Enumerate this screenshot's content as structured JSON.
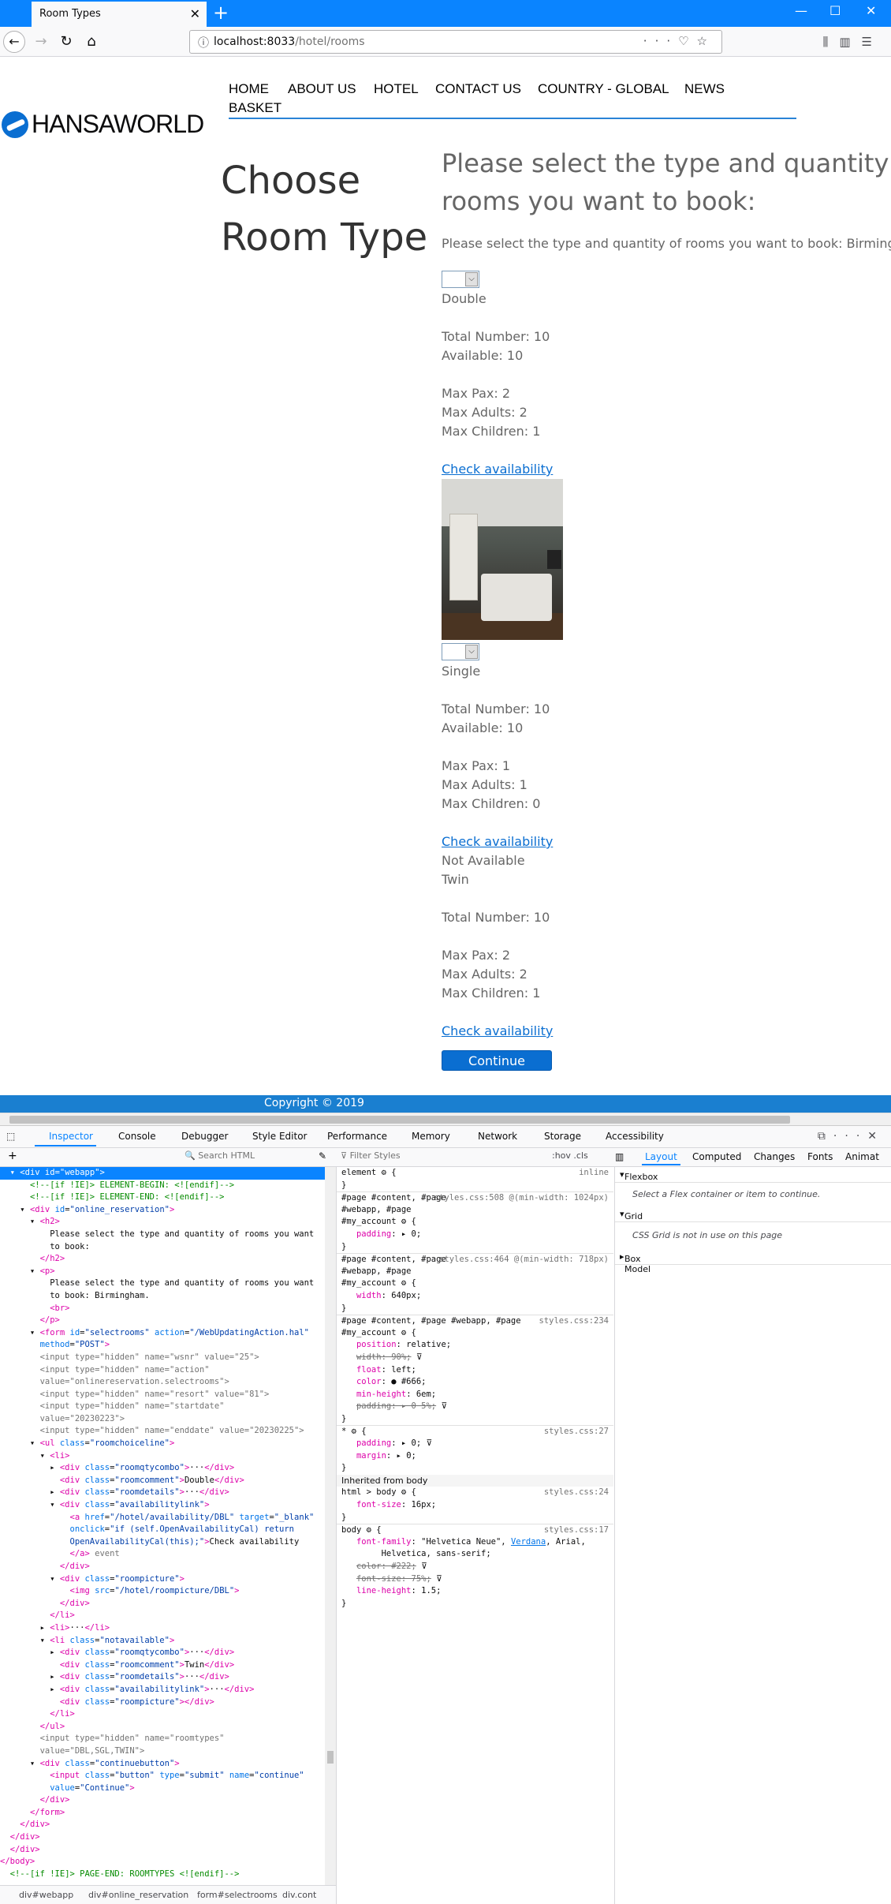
{
  "browser": {
    "tab_title": "Room Types",
    "url_host": "localhost:8033",
    "url_path": "/hotel/rooms"
  },
  "site": {
    "logo_text": "HANSAWORLD",
    "menu": [
      "HOME",
      "ABOUT US",
      "HOTEL",
      "CONTACT US",
      "COUNTRY - GLOBAL",
      "NEWS",
      "BASKET"
    ],
    "page_title_line1": "Choose",
    "page_title_line2": "Room Type",
    "heading_line1": "Please select the type and quantity of",
    "heading_line2": "rooms you want to book:",
    "lead": "Please select the type and quantity of rooms you want to book: Birmingham.",
    "rooms": [
      {
        "name": "Double",
        "total": "Total Number: 10",
        "available": "Available: 10",
        "max_pax": "Max Pax: 2",
        "max_adults": "Max Adults: 2",
        "max_children": "Max Children: 1",
        "link": "Check availability"
      },
      {
        "name": "Single",
        "total": "Total Number: 10",
        "available": "Available: 10",
        "max_pax": "Max Pax: 1",
        "max_adults": "Max Adults: 1",
        "max_children": "Max Children: 0",
        "link": "Check availability"
      },
      {
        "not_available": "Not Available",
        "name": "Twin",
        "total": "Total Number: 10",
        "max_pax": "Max Pax: 2",
        "max_adults": "Max Adults: 2",
        "max_children": "Max Children: 1",
        "link": "Check availability"
      }
    ],
    "continue_label": "Continue",
    "footer": "Copyright © 2019"
  },
  "devtools": {
    "tabs": [
      "Inspector",
      "Console",
      "Debugger",
      "Style Editor",
      "Performance",
      "Memory",
      "Network",
      "Storage",
      "Accessibility"
    ],
    "search_placeholder": "Search HTML",
    "filter_placeholder": "Filter Styles",
    "pseudo_toggles": ":hov .cls",
    "layout_tabs": [
      "Layout",
      "Computed",
      "Changes",
      "Fonts",
      "Animat"
    ],
    "flexbox_label": "Flexbox",
    "flexbox_note": "Select a Flex container or item to continue.",
    "grid_label": "Grid",
    "grid_note": "CSS Grid is not in use on this page",
    "boxmodel_label": "Box Model",
    "breadcrumb": [
      "div#webapp",
      "div#online_reservation",
      "form#selectrooms",
      "div.cont"
    ],
    "inherited_label": "Inherited from body"
  }
}
